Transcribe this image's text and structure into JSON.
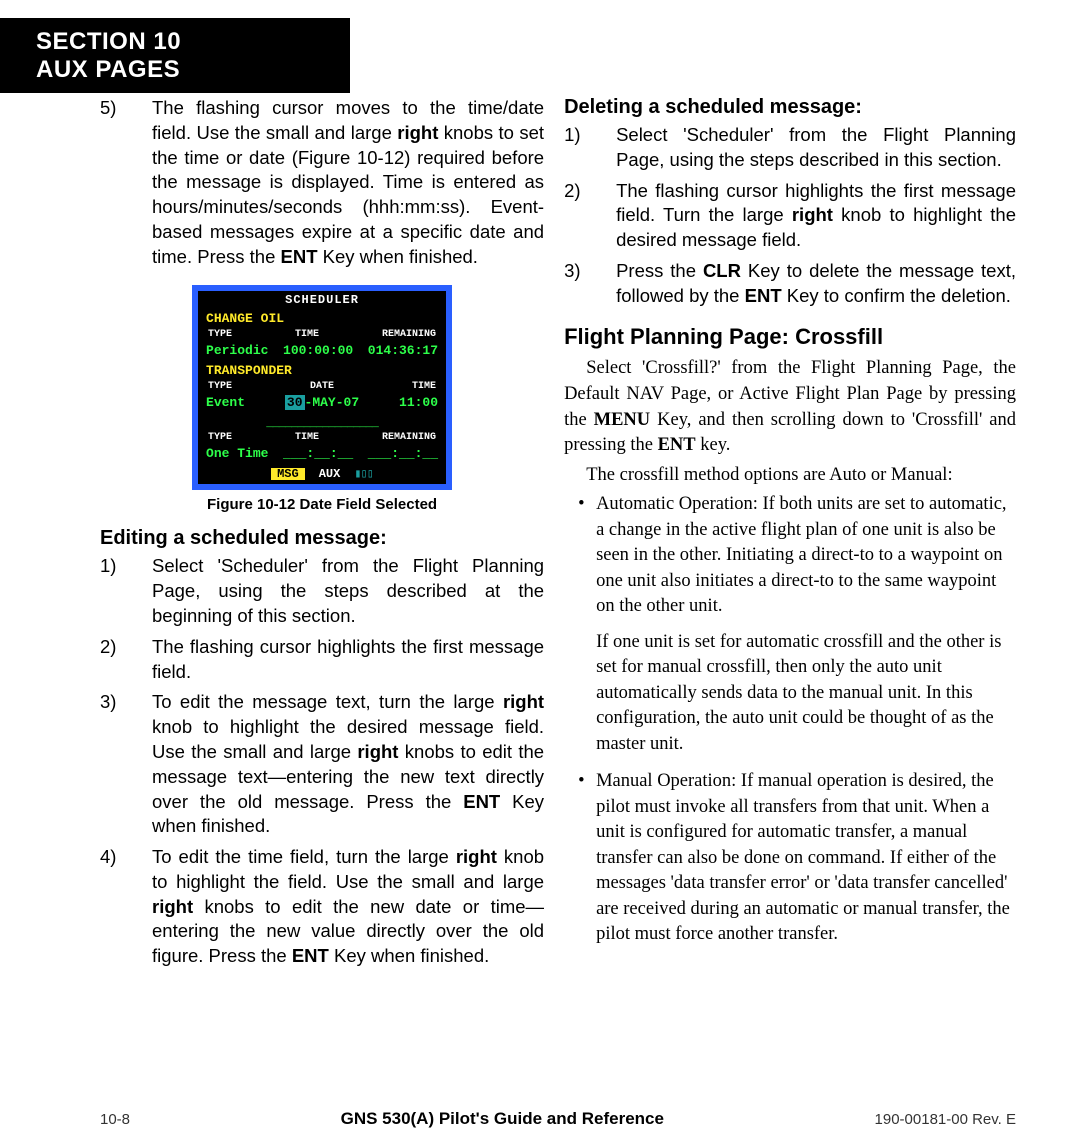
{
  "header": {
    "line1": "SECTION 10",
    "line2": "AUX PAGES"
  },
  "left_col": {
    "step5": {
      "num": "5)",
      "text_a": "The flashing cursor moves to the time/date field. Use the small and large ",
      "kw1": "right",
      "text_b": " knobs to set the time or date (Figure 10-12) required before the message is displayed.  Time is entered as hours/minutes/seconds (hhh:mm:ss).  Event-based messages expire at a specific date and time.  Press the ",
      "kw2": "ENT",
      "text_c": " Key when finished."
    },
    "fig_caption": "Figure 10-12  Date Field Selected",
    "edit_heading": "Editing a scheduled message:",
    "edit_steps": [
      {
        "num": "1)",
        "text": "Select 'Scheduler' from the Flight Planning Page, using the steps described at the beginning of this section."
      },
      {
        "num": "2)",
        "text": "The flashing cursor highlights the first message field."
      },
      {
        "num": "3)",
        "a": "To edit the message text, turn the large ",
        "k1": "right",
        "b": " knob to highlight the desired message field.  Use the small and large ",
        "k2": "right",
        "c": " knobs to edit the message text—entering the new text directly over the old message.  Press the ",
        "k3": "ENT",
        "d": " Key when finished."
      },
      {
        "num": "4)",
        "a": "To edit the time field, turn the large ",
        "k1": "right",
        "b": " knob to highlight the field.  Use the small and large ",
        "k2": "right",
        "c": " knobs to edit the new date or time—entering the new value directly over the old figure.  Press the ",
        "k3": "ENT",
        "d": " Key when finished."
      }
    ]
  },
  "right_col": {
    "del_heading": "Deleting a scheduled message:",
    "del_steps": [
      {
        "num": "1)",
        "text": "Select 'Scheduler' from the Flight Planning Page, using the steps described in this section."
      },
      {
        "num": "2)",
        "a": "The flashing cursor highlights the first message field.  Turn the large ",
        "k1": "right",
        "b": " knob to highlight the desired message field."
      },
      {
        "num": "3)",
        "a": "Press the ",
        "k1": "CLR",
        "b": " Key to delete the message text, followed by the ",
        "k2": "ENT",
        "c": " Key to confirm the deletion."
      }
    ],
    "crossfill_heading": "Flight Planning Page: Crossfill",
    "p1": {
      "a": "Select 'Crossfill?' from the Flight Planning Page, the Default NAV Page, or Active Flight Plan Page by pressing the ",
      "k1": "MENU",
      "b": " Key, and then scrolling down to 'Crossfill' and pressing the ",
      "k2": "ENT",
      "c": " key."
    },
    "p2": "The crossfill method options are Auto or Manual:",
    "b1a": "Automatic Operation:  If both units are set to automatic, a change in the active flight plan of one unit is also be seen in the other.  Initiating a direct-to to a waypoint on one unit also initiates a direct-to to the same waypoint on the other unit.",
    "b1b": "If one unit is set for automatic crossfill and the other is set for manual crossfill, then only the auto unit automatically sends data to the manual unit.  In this configuration, the auto unit could be thought of as the master unit.",
    "b2": "Manual Operation:  If manual operation is desired, the pilot must invoke all transfers from that unit.  When a unit is configured for automatic transfer, a manual transfer can also be done on command.  If either of the messages 'data transfer error' or  'data transfer cancelled' are received during an automatic or manual transfer, the pilot must force another transfer."
  },
  "screen": {
    "title": "SCHEDULER",
    "r1_name": "CHANGE OIL",
    "h1": {
      "c1": "TYPE",
      "c2": "TIME",
      "c3": "REMAINING"
    },
    "d1": {
      "c1": "Periodic",
      "c2": "100:00:00",
      "c3": "014:36:17"
    },
    "r2_name": "TRANSPONDER",
    "h2": {
      "c1": "TYPE",
      "c2": "DATE",
      "c3": "TIME"
    },
    "d2": {
      "c1": "Event",
      "c2_hl": "30",
      "c2_rest": "-MAY-07",
      "c3": "11:00"
    },
    "dashes": "__________________",
    "h3": {
      "c1": "TYPE",
      "c2": "TIME",
      "c3": "REMAINING"
    },
    "d3": {
      "c1": "One Time",
      "c2": "___:__:__",
      "c3": "___:__:__"
    },
    "footer": {
      "msg": "MSG",
      "aux": "AUX",
      "prog": "▮▯▯"
    }
  },
  "footer": {
    "page": "10-8",
    "title": "GNS 530(A) Pilot's Guide and Reference",
    "rev": "190-00181-00  Rev. E"
  }
}
